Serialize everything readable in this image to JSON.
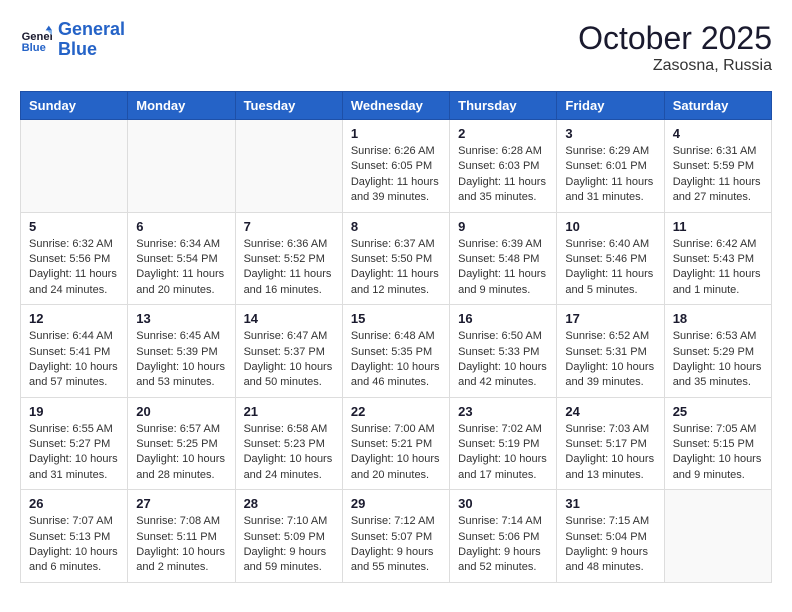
{
  "header": {
    "logo_line1": "General",
    "logo_line2": "Blue",
    "month": "October 2025",
    "location": "Zasosna, Russia"
  },
  "weekdays": [
    "Sunday",
    "Monday",
    "Tuesday",
    "Wednesday",
    "Thursday",
    "Friday",
    "Saturday"
  ],
  "weeks": [
    [
      {
        "day": "",
        "info": ""
      },
      {
        "day": "",
        "info": ""
      },
      {
        "day": "",
        "info": ""
      },
      {
        "day": "1",
        "info": "Sunrise: 6:26 AM\nSunset: 6:05 PM\nDaylight: 11 hours\nand 39 minutes."
      },
      {
        "day": "2",
        "info": "Sunrise: 6:28 AM\nSunset: 6:03 PM\nDaylight: 11 hours\nand 35 minutes."
      },
      {
        "day": "3",
        "info": "Sunrise: 6:29 AM\nSunset: 6:01 PM\nDaylight: 11 hours\nand 31 minutes."
      },
      {
        "day": "4",
        "info": "Sunrise: 6:31 AM\nSunset: 5:59 PM\nDaylight: 11 hours\nand 27 minutes."
      }
    ],
    [
      {
        "day": "5",
        "info": "Sunrise: 6:32 AM\nSunset: 5:56 PM\nDaylight: 11 hours\nand 24 minutes."
      },
      {
        "day": "6",
        "info": "Sunrise: 6:34 AM\nSunset: 5:54 PM\nDaylight: 11 hours\nand 20 minutes."
      },
      {
        "day": "7",
        "info": "Sunrise: 6:36 AM\nSunset: 5:52 PM\nDaylight: 11 hours\nand 16 minutes."
      },
      {
        "day": "8",
        "info": "Sunrise: 6:37 AM\nSunset: 5:50 PM\nDaylight: 11 hours\nand 12 minutes."
      },
      {
        "day": "9",
        "info": "Sunrise: 6:39 AM\nSunset: 5:48 PM\nDaylight: 11 hours\nand 9 minutes."
      },
      {
        "day": "10",
        "info": "Sunrise: 6:40 AM\nSunset: 5:46 PM\nDaylight: 11 hours\nand 5 minutes."
      },
      {
        "day": "11",
        "info": "Sunrise: 6:42 AM\nSunset: 5:43 PM\nDaylight: 11 hours\nand 1 minute."
      }
    ],
    [
      {
        "day": "12",
        "info": "Sunrise: 6:44 AM\nSunset: 5:41 PM\nDaylight: 10 hours\nand 57 minutes."
      },
      {
        "day": "13",
        "info": "Sunrise: 6:45 AM\nSunset: 5:39 PM\nDaylight: 10 hours\nand 53 minutes."
      },
      {
        "day": "14",
        "info": "Sunrise: 6:47 AM\nSunset: 5:37 PM\nDaylight: 10 hours\nand 50 minutes."
      },
      {
        "day": "15",
        "info": "Sunrise: 6:48 AM\nSunset: 5:35 PM\nDaylight: 10 hours\nand 46 minutes."
      },
      {
        "day": "16",
        "info": "Sunrise: 6:50 AM\nSunset: 5:33 PM\nDaylight: 10 hours\nand 42 minutes."
      },
      {
        "day": "17",
        "info": "Sunrise: 6:52 AM\nSunset: 5:31 PM\nDaylight: 10 hours\nand 39 minutes."
      },
      {
        "day": "18",
        "info": "Sunrise: 6:53 AM\nSunset: 5:29 PM\nDaylight: 10 hours\nand 35 minutes."
      }
    ],
    [
      {
        "day": "19",
        "info": "Sunrise: 6:55 AM\nSunset: 5:27 PM\nDaylight: 10 hours\nand 31 minutes."
      },
      {
        "day": "20",
        "info": "Sunrise: 6:57 AM\nSunset: 5:25 PM\nDaylight: 10 hours\nand 28 minutes."
      },
      {
        "day": "21",
        "info": "Sunrise: 6:58 AM\nSunset: 5:23 PM\nDaylight: 10 hours\nand 24 minutes."
      },
      {
        "day": "22",
        "info": "Sunrise: 7:00 AM\nSunset: 5:21 PM\nDaylight: 10 hours\nand 20 minutes."
      },
      {
        "day": "23",
        "info": "Sunrise: 7:02 AM\nSunset: 5:19 PM\nDaylight: 10 hours\nand 17 minutes."
      },
      {
        "day": "24",
        "info": "Sunrise: 7:03 AM\nSunset: 5:17 PM\nDaylight: 10 hours\nand 13 minutes."
      },
      {
        "day": "25",
        "info": "Sunrise: 7:05 AM\nSunset: 5:15 PM\nDaylight: 10 hours\nand 9 minutes."
      }
    ],
    [
      {
        "day": "26",
        "info": "Sunrise: 7:07 AM\nSunset: 5:13 PM\nDaylight: 10 hours\nand 6 minutes."
      },
      {
        "day": "27",
        "info": "Sunrise: 7:08 AM\nSunset: 5:11 PM\nDaylight: 10 hours\nand 2 minutes."
      },
      {
        "day": "28",
        "info": "Sunrise: 7:10 AM\nSunset: 5:09 PM\nDaylight: 9 hours\nand 59 minutes."
      },
      {
        "day": "29",
        "info": "Sunrise: 7:12 AM\nSunset: 5:07 PM\nDaylight: 9 hours\nand 55 minutes."
      },
      {
        "day": "30",
        "info": "Sunrise: 7:14 AM\nSunset: 5:06 PM\nDaylight: 9 hours\nand 52 minutes."
      },
      {
        "day": "31",
        "info": "Sunrise: 7:15 AM\nSunset: 5:04 PM\nDaylight: 9 hours\nand 48 minutes."
      },
      {
        "day": "",
        "info": ""
      }
    ]
  ]
}
